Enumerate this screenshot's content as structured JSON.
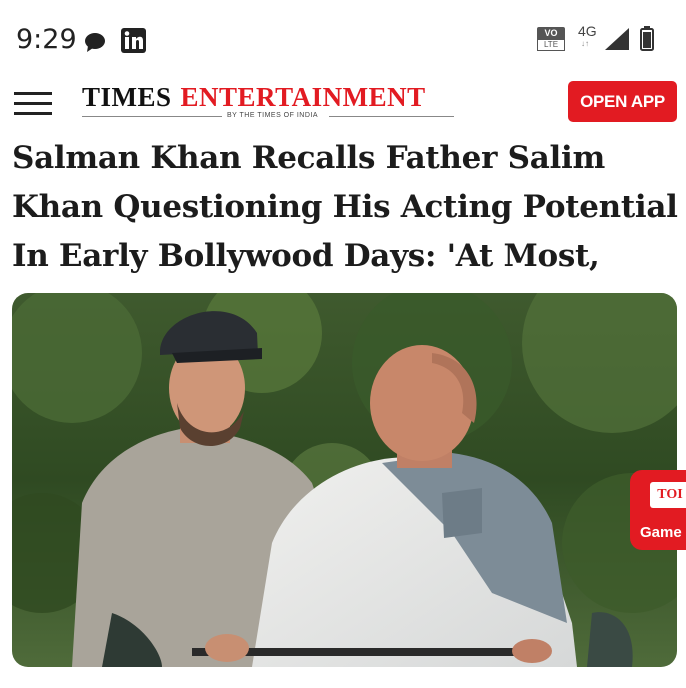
{
  "status_bar": {
    "time": "9:29",
    "icons": [
      "chat-bubble-icon",
      "linkedin-icon",
      "volte-icon",
      "network-4g-icon",
      "signal-icon",
      "battery-icon"
    ],
    "volte_top": "VO",
    "volte_bottom": "LTE",
    "network": "4G"
  },
  "header": {
    "logo_word1": "TIMES",
    "logo_word2": "ENTERTAINMENT",
    "logo_tagline": "BY THE TIMES OF INDIA",
    "open_app_label": "OPEN APP",
    "brand_color": "#e21b22"
  },
  "article": {
    "headline": "Salman Khan Recalls Father Salim Khan Questioning His Acting Potential In Early Bollywood Days: 'At Most,"
  },
  "game_badge": {
    "logo_text": "TOI",
    "label": "Game"
  }
}
